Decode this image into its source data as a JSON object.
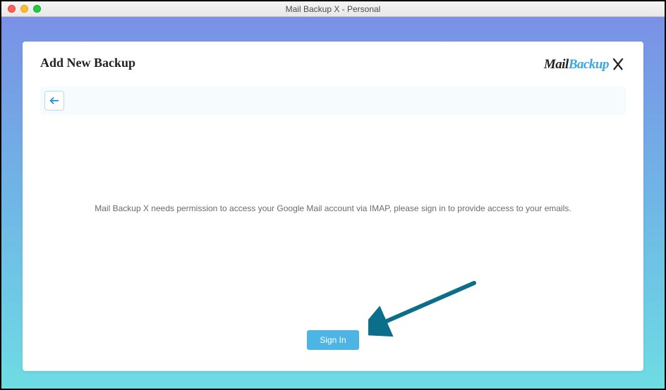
{
  "window": {
    "title": "Mail Backup X - Personal"
  },
  "header": {
    "page_title": "Add New Backup",
    "logo": {
      "part1": "Mail",
      "part2": "Backup",
      "part3": "X"
    }
  },
  "toolbar": {
    "back_button_label": "Back"
  },
  "main": {
    "permission_message": "Mail Backup X needs permission to access your Google Mail account via IMAP, please sign in to provide access to your emails."
  },
  "footer": {
    "signin_label": "Sign In"
  }
}
